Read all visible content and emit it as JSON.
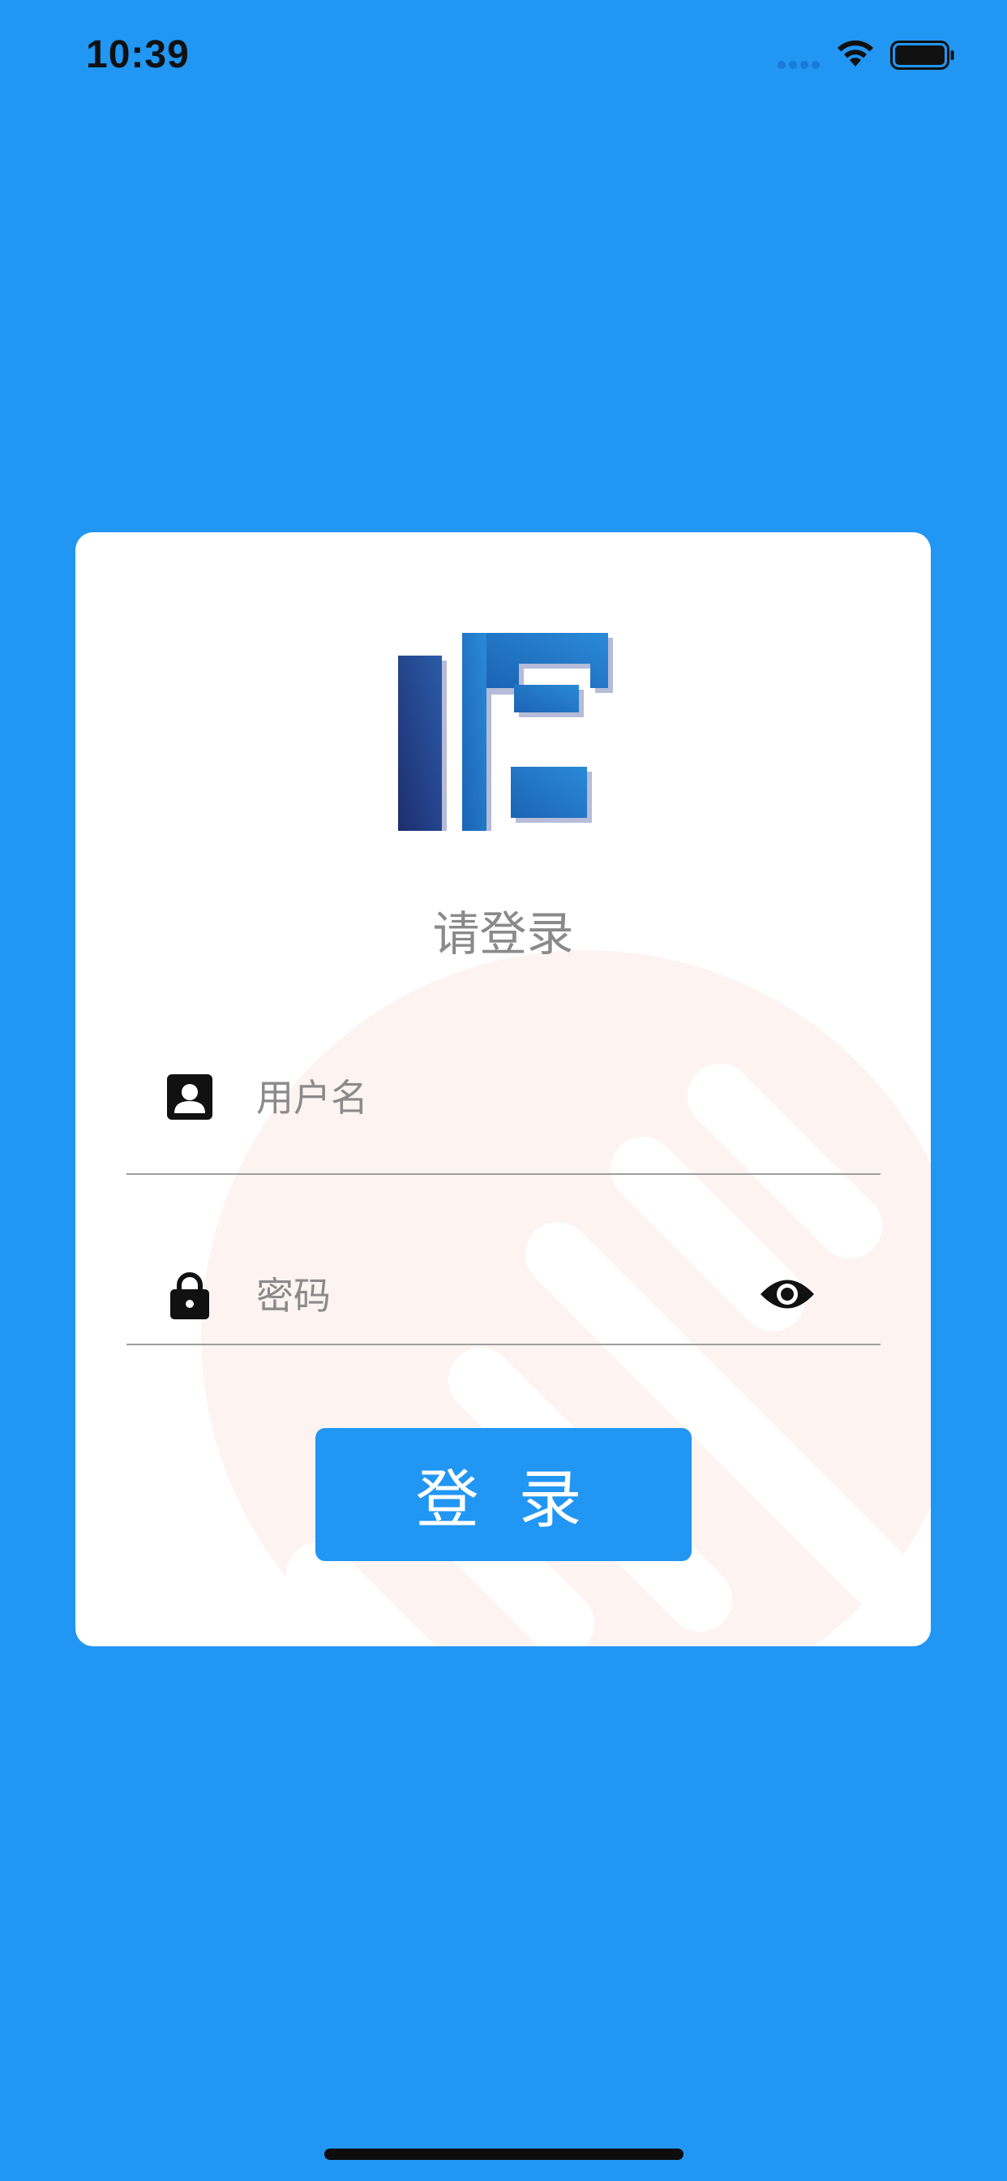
{
  "status_bar": {
    "time": "10:39"
  },
  "login": {
    "title": "请登录",
    "username_placeholder": "用户名",
    "username_value": "",
    "password_placeholder": "密码",
    "password_value": "",
    "button_label": "登 录"
  },
  "icons": {
    "username": "account-box-icon",
    "password": "lock-icon",
    "toggle_visibility": "eye-icon",
    "wifi": "wifi-icon",
    "battery": "battery-icon",
    "signal": "signal-dots-icon",
    "logo": "app-logo"
  },
  "colors": {
    "background": "#2196F3",
    "button": "#2196F3",
    "card": "#FFFFFF",
    "watermark": "#FDF4F2",
    "logo_dark": "#213A8A",
    "logo_light": "#1E78C8",
    "placeholder": "#8A8A8A"
  }
}
